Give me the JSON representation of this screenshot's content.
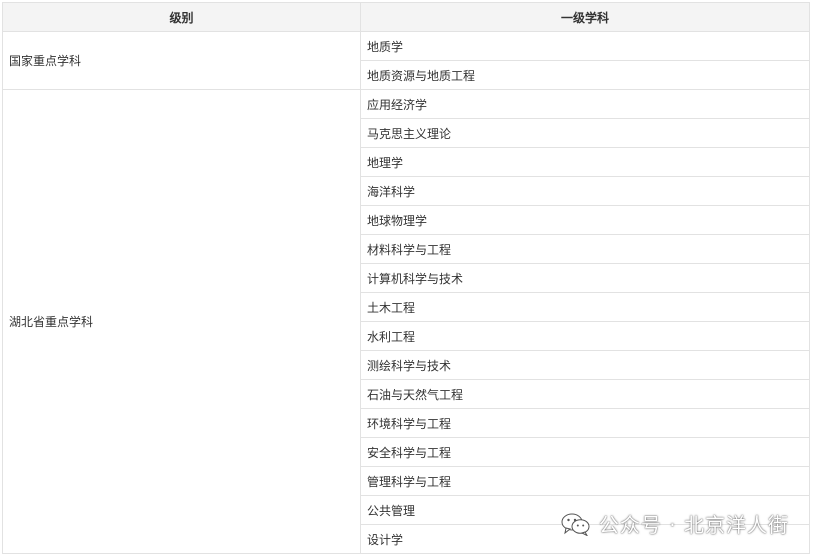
{
  "table": {
    "headers": [
      "级别",
      "一级学科"
    ],
    "groups": [
      {
        "level": "国家重点学科",
        "disciplines": [
          "地质学",
          "地质资源与地质工程"
        ]
      },
      {
        "level": "湖北省重点学科",
        "disciplines": [
          "应用经济学",
          "马克思主义理论",
          "地理学",
          "海洋科学",
          "地球物理学",
          "材料科学与工程",
          "计算机科学与技术",
          "土木工程",
          "水利工程",
          "测绘科学与技术",
          "石油与天然气工程",
          "环境科学与工程",
          "安全科学与工程",
          "管理科学与工程",
          "公共管理",
          "设计学"
        ]
      }
    ]
  },
  "watermark": {
    "icon": "wechat-icon",
    "text": "公众号 · 北京洋人街"
  }
}
